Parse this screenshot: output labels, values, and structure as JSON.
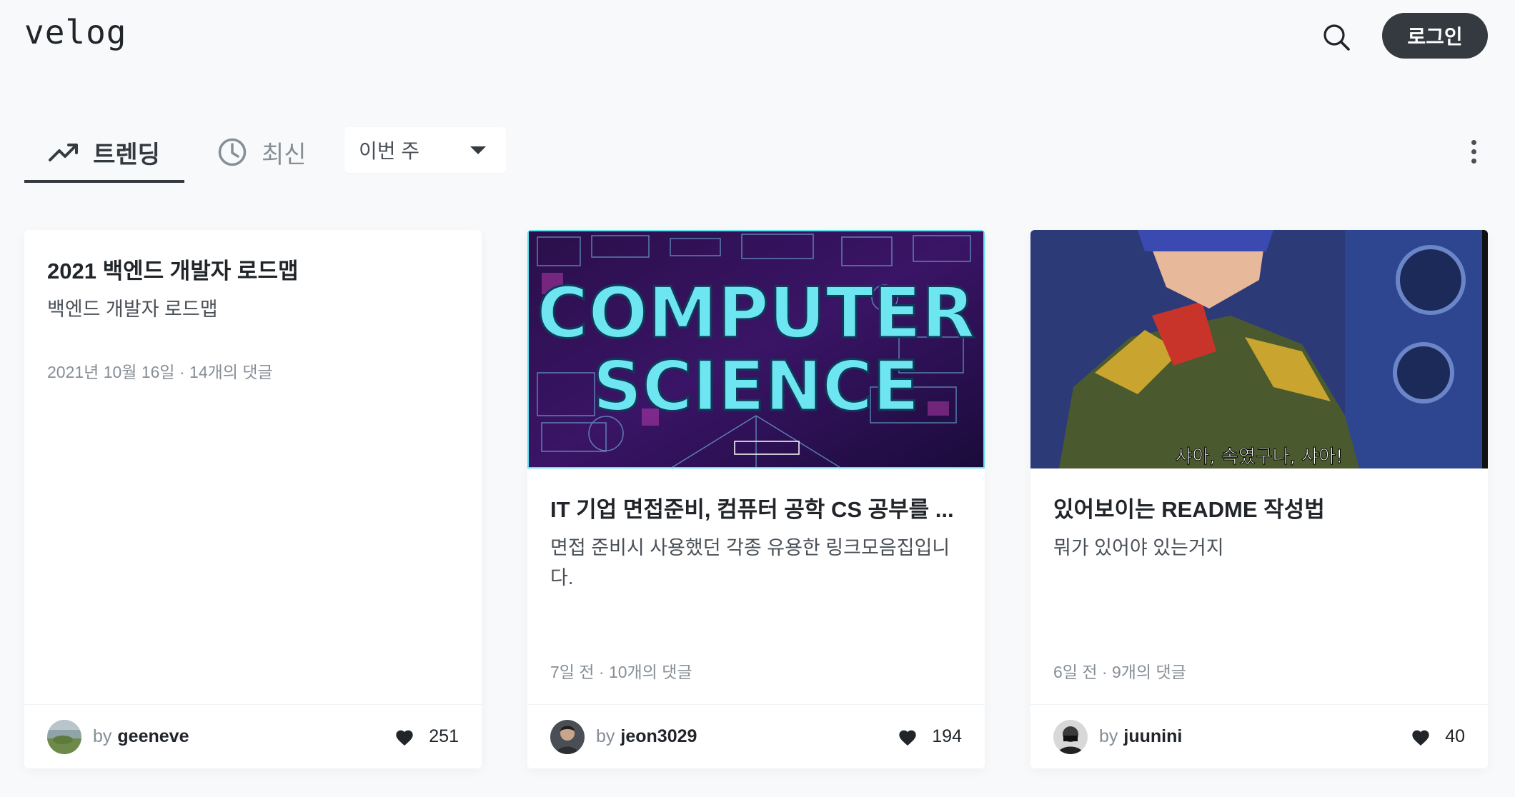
{
  "header": {
    "logo": "velog",
    "search_icon": "search-icon",
    "login_label": "로그인"
  },
  "tabs": {
    "trending": {
      "label": "트렌딩",
      "icon": "trending-up-icon",
      "active": true
    },
    "recent": {
      "label": "최신",
      "icon": "clock-icon",
      "active": false
    },
    "period": {
      "selected": "이번 주"
    },
    "more_icon": "more-vertical-icon"
  },
  "colors": {
    "background": "#f8f9fa",
    "primary_dark": "#343a40",
    "muted": "#868e96"
  },
  "cards": [
    {
      "title": "2021 백엔드 개발자 로드맵",
      "description": "백엔드 개발자 로드맵",
      "meta": "2021년 10월 16일 · 14개의 댓글",
      "author_prefix": "by",
      "author": "geeneve",
      "likes": "251"
    },
    {
      "title": "IT 기업 면접준비, 컴퓨터 공학 CS 공부를 ...",
      "description": "면접 준비시 사용했던 각종 유용한 링크모음집입니다.",
      "meta": "7일 전 · 10개의 댓글",
      "thumbnail_text_1": "COMPUTER",
      "thumbnail_text_2": "SCIENCE",
      "author_prefix": "by",
      "author": "jeon3029",
      "likes": "194"
    },
    {
      "title": "있어보이는 README 작성법",
      "description": "뭐가 있어야 있는거지",
      "meta": "6일 전 · 9개의 댓글",
      "thumbnail_caption": "샤아, 속였구나, 샤아!",
      "author_prefix": "by",
      "author": "juunini",
      "likes": "40"
    }
  ]
}
